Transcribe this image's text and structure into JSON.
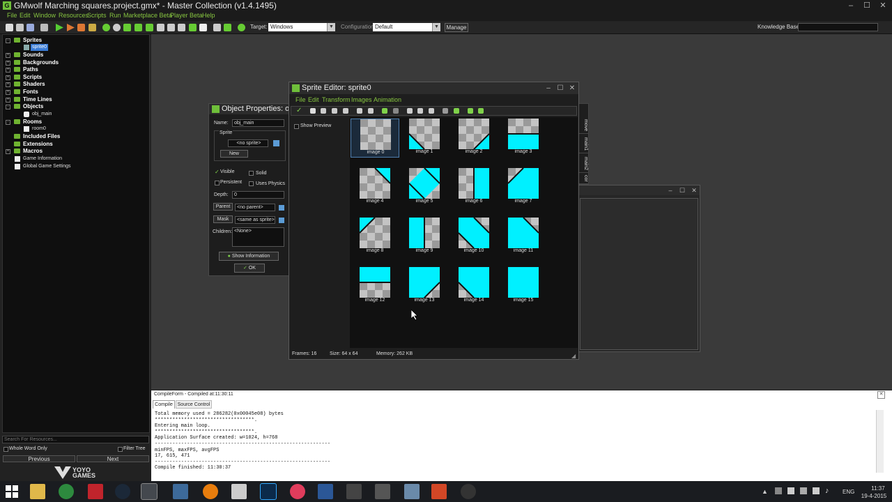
{
  "window": {
    "title": "GMwolf Marching squares.project.gmx*  -  Master Collection (v1.4.1495)",
    "min": "–",
    "max": "☐",
    "close": "✕"
  },
  "menu": [
    "File",
    "Edit",
    "Window",
    "Resources",
    "Scripts",
    "Run",
    "Marketplace Beta",
    "Player Beta",
    "Help"
  ],
  "toolbar": {
    "target_label": "Target:",
    "target_value": "Windows",
    "config_label": "Configuration:",
    "config_value": "Default",
    "manage_label": "Manage",
    "kb_label": "Knowledge Base:"
  },
  "tree": {
    "nodes": [
      {
        "label": "Sprites",
        "expanded": true
      },
      {
        "label": "Sounds"
      },
      {
        "label": "Backgrounds"
      },
      {
        "label": "Paths"
      },
      {
        "label": "Scripts"
      },
      {
        "label": "Shaders"
      },
      {
        "label": "Fonts"
      },
      {
        "label": "Time Lines"
      },
      {
        "label": "Objects",
        "expanded": true
      },
      {
        "label": "Rooms",
        "expanded": true
      },
      {
        "label": "Included Files"
      },
      {
        "label": "Extensions"
      },
      {
        "label": "Macros"
      }
    ],
    "children": {
      "sprite": "sprite0",
      "object": "obj_main",
      "room": "room0"
    },
    "extras": [
      "Game Information",
      "Global Game Settings"
    ],
    "search_placeholder": "Search For Resources...",
    "whole_word": "Whole Word Only",
    "filter": "Filter Tree",
    "prev": "Previous",
    "next": "Next",
    "logo_text": "YOYO GAMES"
  },
  "obj_props": {
    "title": "Object Properties: obj_main",
    "name_label": "Name:",
    "name_value": "obj_main",
    "sprite_group": "Sprite",
    "sprite_value": "<no sprite>",
    "new_btn": "New",
    "visible": "Visible",
    "solid": "Solid",
    "persistent": "Persistent",
    "uses_physics": "Uses Physics",
    "depth_label": "Depth:",
    "depth_value": "0",
    "parent_btn": "Parent",
    "parent_value": "<no parent>",
    "mask_btn": "Mask",
    "mask_value": "<same as sprite>",
    "children_label": "Children:",
    "children_value": "<None>",
    "show_info": "Show Information",
    "ok": "OK"
  },
  "sprite_editor": {
    "title": "Sprite Editor: sprite0",
    "menu": [
      "File",
      "Edit",
      "Transform",
      "Images",
      "Animation"
    ],
    "show_preview": "Show Preview",
    "status_frames": "Frames: 16",
    "status_size": "Size: 64 x 64",
    "status_memory": "Memory: 262 KB",
    "images": [
      "image 0",
      "image 1",
      "image 2",
      "image 3",
      "image 4",
      "image 5",
      "image 6",
      "image 7",
      "image 8",
      "image 9",
      "image 10",
      "image 11",
      "image 12",
      "image 13",
      "image 14",
      "image 15"
    ],
    "selected_index": 0,
    "fill_color": "#00f0ff"
  },
  "side_tabs": [
    "move",
    "main1",
    "main2",
    "cor"
  ],
  "compile": {
    "title": "CompileForm - Compiled at:11:30:11",
    "tabs": [
      "Compile",
      "Source Control"
    ],
    "lines": [
      "Total memory used = 286282(0x00045e08) bytes",
      "**********************************.",
      "Entering main loop.",
      "**********************************.",
      "Application Surface created: w=1024, h=768",
      "------------------------------------------------------------",
      "minFPS, maxFPS, avgFPS",
      "17, 615, 471",
      "------------------------------------------------------------",
      "Compile finished: 11:30:37"
    ]
  },
  "taskbar": {
    "time": "11:37",
    "date": "19-4-2015",
    "lang": "ENG"
  }
}
